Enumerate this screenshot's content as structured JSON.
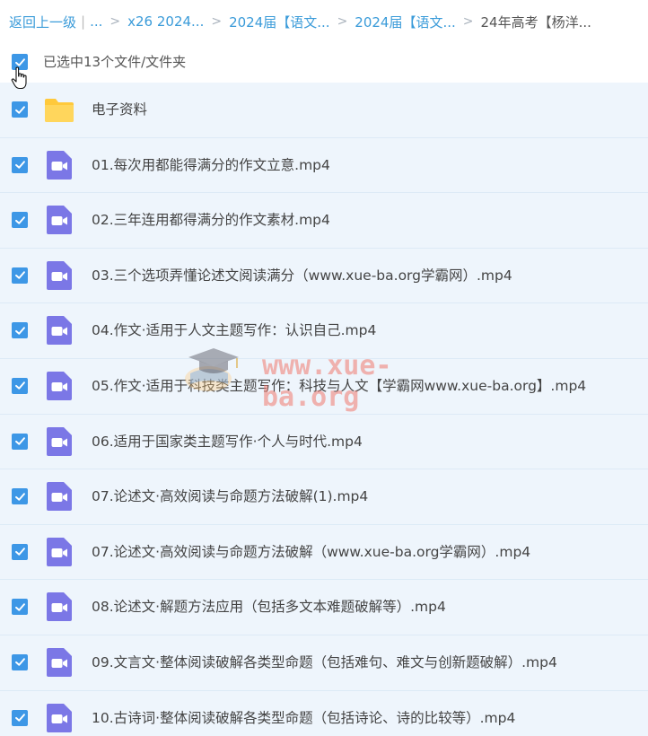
{
  "breadcrumb": {
    "back": "返回上一级",
    "ellipsis": "...",
    "items": [
      "x26 2024...",
      "2024届【语文...",
      "2024届【语文..."
    ],
    "current": "24年高考【杨洋..."
  },
  "selection": {
    "label": "已选中13个文件/文件夹"
  },
  "colors": {
    "accent": "#3d97e6",
    "folder": "#ffc93b",
    "video": "#7b77e6"
  },
  "files": [
    {
      "name": "电子资料",
      "type": "folder-icon"
    },
    {
      "name": "01.每次用都能得满分的作文立意.mp4",
      "type": "video-icon"
    },
    {
      "name": "02.三年连用都得满分的作文素材.mp4",
      "type": "video-icon"
    },
    {
      "name": "03.三个选项弄懂论述文阅读满分（www.xue-ba.org学霸网）.mp4",
      "type": "video-icon"
    },
    {
      "name": "04.作文·适用于人文主题写作：认识自己.mp4",
      "type": "video-icon"
    },
    {
      "name": "05.作文·适用于科技类主题写作：科技与人文【学霸网www.xue-ba.org】.mp4",
      "type": "video-icon"
    },
    {
      "name": "06.适用于国家类主题写作·个人与时代.mp4",
      "type": "video-icon"
    },
    {
      "name": "07.论述文·高效阅读与命题方法破解(1).mp4",
      "type": "video-icon"
    },
    {
      "name": "07.论述文·高效阅读与命题方法破解（www.xue-ba.org学霸网）.mp4",
      "type": "video-icon"
    },
    {
      "name": "08.论述文·解题方法应用（包括多文本难题破解等）.mp4",
      "type": "video-icon"
    },
    {
      "name": "09.文言文·整体阅读破解各类型命题（包括难句、难文与创新题破解）.mp4",
      "type": "video-icon"
    },
    {
      "name": "10.古诗词·整体阅读破解各类型命题（包括诗论、诗的比较等）.mp4",
      "type": "video-icon"
    }
  ],
  "watermark": {
    "text": "www.xue-ba.org"
  }
}
